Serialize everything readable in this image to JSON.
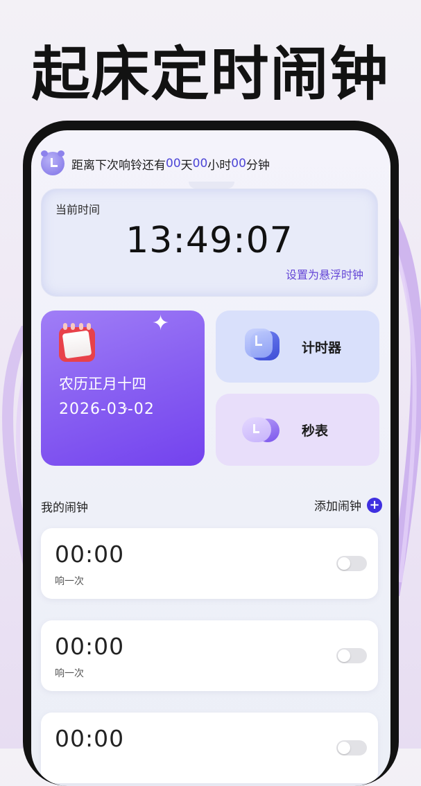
{
  "promo": {
    "title": "起床定时闹钟"
  },
  "countdown": {
    "prefix": "距离下次响铃还有",
    "days": "00",
    "days_unit": "天",
    "hours": "00",
    "hours_unit": "小时",
    "minutes": "00",
    "minutes_unit": "分钟"
  },
  "current_time": {
    "label": "当前时间",
    "value": "13:49:07",
    "float_link": "设置为悬浮时钟"
  },
  "lunar": {
    "lunar_text": "农历正月十四",
    "date": "2026-03-02"
  },
  "tools": {
    "timer_label": "计时器",
    "stopwatch_label": "秒表"
  },
  "alarms_section": {
    "title": "我的闹钟",
    "add_label": "添加闹钟"
  },
  "alarms": [
    {
      "time": "00:00",
      "repeat": "响一次",
      "enabled": false
    },
    {
      "time": "00:00",
      "repeat": "响一次",
      "enabled": false
    },
    {
      "time": "00:00",
      "repeat": "",
      "enabled": false
    }
  ],
  "colors": {
    "accent": "#4d46d6",
    "lunar_card": "#7f53f0",
    "link": "#6446d6"
  }
}
